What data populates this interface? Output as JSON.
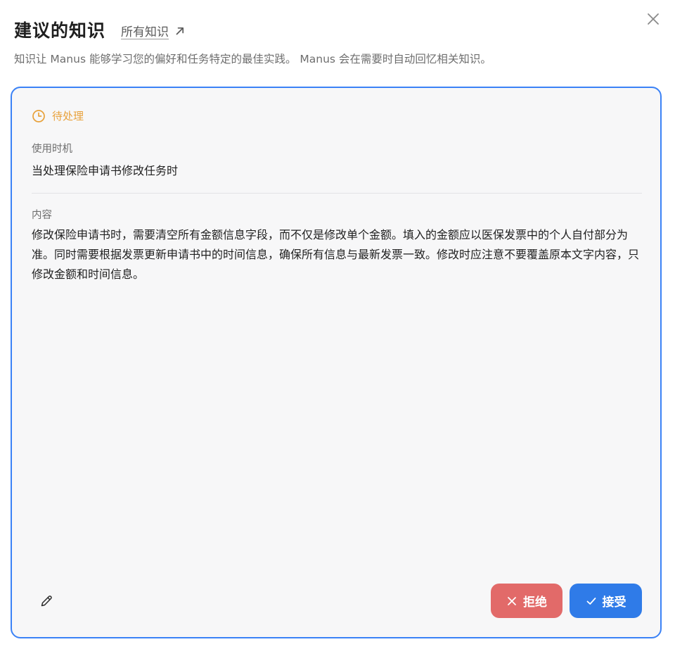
{
  "dialog": {
    "title": "建议的知识",
    "all_knowledge_link": "所有知识",
    "subtitle": "知识让 Manus 能够学习您的偏好和任务特定的最佳实践。 Manus 会在需要时自动回忆相关知识。",
    "close_icon": "close-icon"
  },
  "card": {
    "status": {
      "label": "待处理",
      "icon": "clock-icon",
      "color": "#e8a13a"
    },
    "when_to_use": {
      "label": "使用时机",
      "value": "当处理保险申请书修改任务时"
    },
    "content": {
      "label": "内容",
      "value": "修改保险申请书时，需要清空所有金额信息字段，而不仅是修改单个金额。填入的金额应以医保发票中的个人自付部分为准。同时需要根据发票更新申请书中的时间信息，确保所有信息与最新发票一致。修改时应注意不要覆盖原本文字内容，只修改金额和时间信息。"
    },
    "border_color": "#3b82f6"
  },
  "actions": {
    "edit_icon": "pencil-icon",
    "reject": {
      "label": "拒绝",
      "icon": "x-icon",
      "color": "#e26a69"
    },
    "accept": {
      "label": "接受",
      "icon": "check-icon",
      "color": "#2f7be8"
    }
  }
}
